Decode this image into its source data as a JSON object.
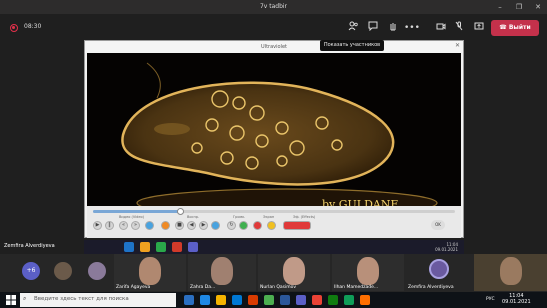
{
  "window": {
    "title": "7v tadbir"
  },
  "meeting": {
    "timer": "08:30",
    "leave_label": "Выйти",
    "tooltip": "Показать участников",
    "more_icon": "•••"
  },
  "shared_window": {
    "title": "Ultraviolet",
    "watermark": "by GULDANE"
  },
  "player": {
    "labels": [
      "Видео (Video)",
      "Воспр.",
      "Громк.",
      "Экран",
      "Эф. (Effects)"
    ],
    "ok_label": "OK",
    "progress": 0.24
  },
  "presenter": {
    "name": "Zemfira Alverdiyeva"
  },
  "inner_taskbar": {
    "time": "11:04",
    "date": "09.01.2021"
  },
  "participants": {
    "more_count": "+6",
    "tiles": [
      {
        "name": "Zarifa Agayeva"
      },
      {
        "name": "Zahra Da..."
      },
      {
        "name": "Nurlan Qasimov"
      },
      {
        "name": "Ilhan Mamedzade..."
      },
      {
        "name": "Zemfira Alverdiyeva"
      }
    ]
  },
  "taskbar": {
    "search_placeholder": "Введите здесь текст для поиска",
    "lang": "РУС",
    "time": "11:04",
    "date": "09.01.2021"
  },
  "colors": {
    "leave": "#c4314b",
    "teams_accent": "#5b5fc7",
    "paramecium": "#c99a3d"
  }
}
